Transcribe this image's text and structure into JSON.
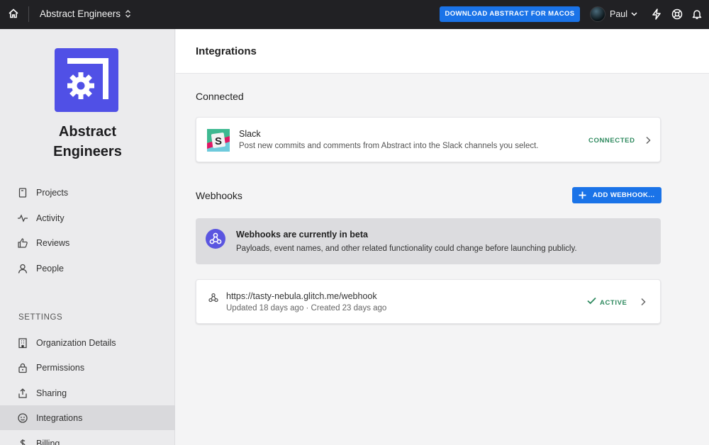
{
  "topbar": {
    "org_name": "Abstract Engineers",
    "download_label": "DOWNLOAD ABSTRACT FOR MACOS",
    "user_name": "Paul",
    "icons": [
      "home-icon",
      "lightning-icon",
      "help-icon",
      "bell-icon"
    ]
  },
  "sidebar": {
    "org_name_line1": "Abstract",
    "org_name_line2": "Engineers",
    "nav": [
      {
        "label": "Projects",
        "icon": "projects-icon"
      },
      {
        "label": "Activity",
        "icon": "activity-icon"
      },
      {
        "label": "Reviews",
        "icon": "reviews-icon"
      },
      {
        "label": "People",
        "icon": "people-icon"
      }
    ],
    "settings_heading": "SETTINGS",
    "settings": [
      {
        "label": "Organization Details",
        "icon": "building-icon"
      },
      {
        "label": "Permissions",
        "icon": "lock-icon"
      },
      {
        "label": "Sharing",
        "icon": "share-icon"
      },
      {
        "label": "Integrations",
        "icon": "integrations-icon",
        "active": true
      },
      {
        "label": "Billing",
        "icon": "dollar-icon"
      }
    ]
  },
  "main": {
    "title": "Integrations",
    "connected_heading": "Connected",
    "slack": {
      "name": "Slack",
      "description": "Post new commits and comments from Abstract into the Slack channels you select.",
      "status": "CONNECTED"
    },
    "webhooks_heading": "Webhooks",
    "add_webhook_label": "ADD WEBHOOK...",
    "beta_notice": {
      "title": "Webhooks are currently in beta",
      "body": "Payloads, event names, and other related functionality could change before launching publicly."
    },
    "webhook": {
      "url": "https://tasty-nebula.glitch.me/webhook",
      "meta": "Updated 18 days ago · Created 23 days ago",
      "status": "ACTIVE"
    }
  },
  "colors": {
    "accent": "#1a73e8",
    "brand": "#5050e6",
    "success": "#2f8a5f",
    "topbar": "#212124"
  }
}
